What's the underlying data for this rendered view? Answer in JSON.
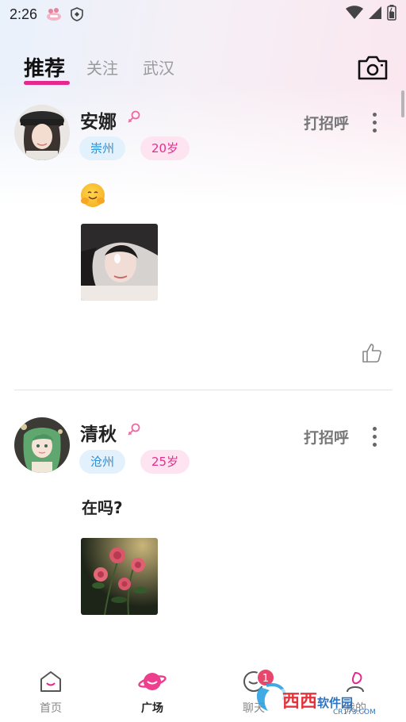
{
  "status_bar": {
    "time": "2:26"
  },
  "top_tabs": [
    {
      "label": "推荐",
      "active": true
    },
    {
      "label": "关注",
      "active": false
    },
    {
      "label": "武汉",
      "active": false
    }
  ],
  "posts": [
    {
      "name": "安娜",
      "city": "崇州",
      "age": "20岁",
      "greet_label": "打招呼",
      "text": "",
      "emoji": "hugging-face"
    },
    {
      "name": "清秋",
      "city": "沧州",
      "age": "25岁",
      "greet_label": "打招呼",
      "text": "在吗?",
      "emoji": ""
    }
  ],
  "bottom_nav": [
    {
      "label": "首页",
      "icon": "home-icon",
      "active": false
    },
    {
      "label": "广场",
      "icon": "planet-icon",
      "active": true
    },
    {
      "label": "聊天",
      "icon": "chat-icon",
      "active": false,
      "badge": "1"
    },
    {
      "label": "我的",
      "icon": "profile-icon",
      "active": false
    }
  ],
  "watermark": {
    "text_main": "西西软件园",
    "text_sub": "CR173.COM"
  },
  "colors": {
    "accent_pink": "#e5288f",
    "city_blue": "#2f8fd6",
    "age_pink": "#e1308c"
  }
}
